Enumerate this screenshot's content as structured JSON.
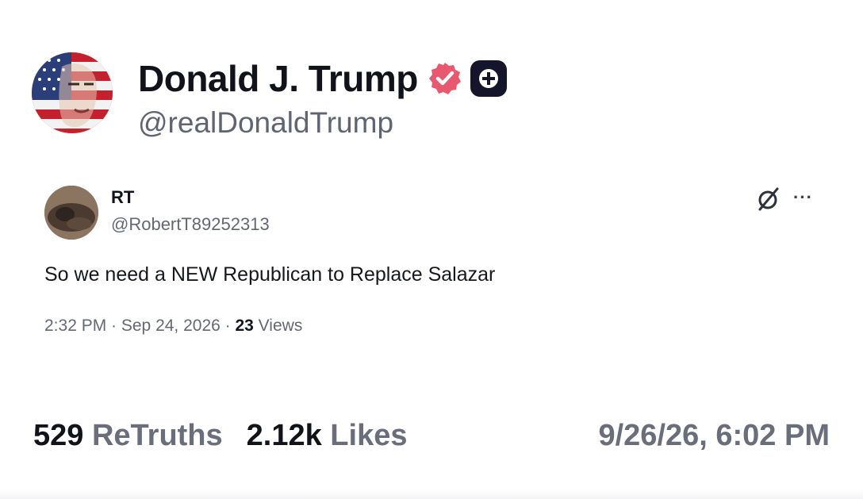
{
  "author": {
    "name": "Donald J. Trump",
    "handle": "@realDonaldTrump",
    "avatar_icon": "flag-portrait-avatar",
    "verified_badge_icon": "verified-badge-icon",
    "verified_color": "#e8586f",
    "plus_badge_icon": "plus-badge-icon"
  },
  "quoted_post": {
    "author_name": "RT",
    "author_handle": "@RobertT89252313",
    "text": "So we need a NEW Republican to Replace Salazar",
    "meta_time": "2:32 PM · Sep 24, 2026 · ",
    "views_count": "23",
    "views_label": " Views",
    "more_label": "···",
    "grok_icon": "grok-icon"
  },
  "stats": {
    "retruths_count": "529",
    "retruths_label": " ReTruths",
    "likes_count": "2.12k",
    "likes_label": " Likes",
    "posted_at": "9/26/26, 6:02 PM"
  }
}
